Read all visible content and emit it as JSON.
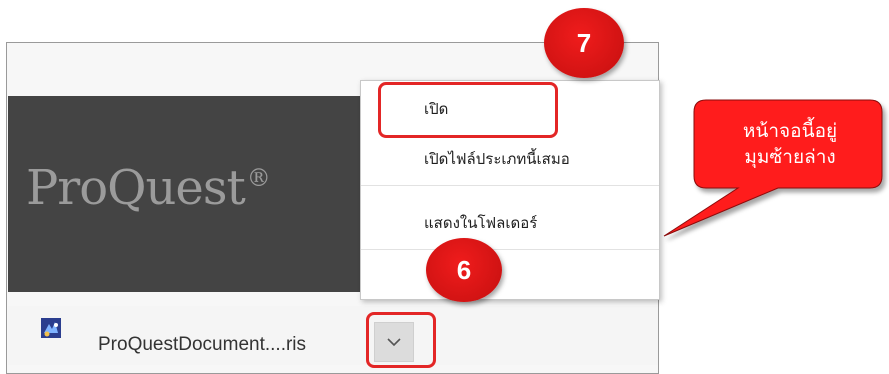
{
  "brand": {
    "logo_text": "ProQuest",
    "logo_mark": "®"
  },
  "download_bar": {
    "file_name": "ProQuestDocument....ris",
    "file_icon": "ris-file-icon",
    "dropdown_icon": "chevron-down-icon"
  },
  "context_menu": {
    "items": [
      {
        "label": "เปิด"
      },
      {
        "label": "เปิดไฟล์ประเภทนี้เสมอ"
      },
      {
        "label": "แสดงในโฟลเดอร์"
      }
    ]
  },
  "annotations": {
    "step_open": "7",
    "step_dropdown": "6",
    "callout": {
      "line1": "หน้าจอนี้อยู่",
      "line2": "มุมซ้ายล่าง"
    },
    "colors": {
      "accent_red": "#e32626",
      "callout_fill": "#ff1a1a"
    }
  }
}
